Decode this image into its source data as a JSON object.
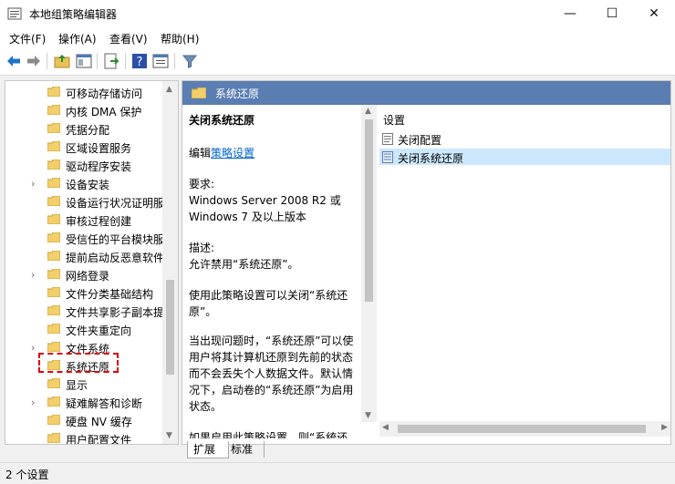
{
  "window": {
    "title": "本地组策略编辑器",
    "minimize": "—",
    "maximize": "☐",
    "close": "✕"
  },
  "menu": [
    "文件(F)",
    "操作(A)",
    "查看(V)",
    "帮助(H)"
  ],
  "tree": {
    "items": [
      {
        "label": "可移动存储访问",
        "expandable": false
      },
      {
        "label": "内核 DMA 保护",
        "expandable": false
      },
      {
        "label": "凭据分配",
        "expandable": false
      },
      {
        "label": "区域设置服务",
        "expandable": false
      },
      {
        "label": "驱动程序安装",
        "expandable": false
      },
      {
        "label": "设备安装",
        "expandable": true
      },
      {
        "label": "设备运行状况证明服",
        "expandable": false
      },
      {
        "label": "审核过程创建",
        "expandable": false
      },
      {
        "label": "受信任的平台模块服",
        "expandable": false
      },
      {
        "label": "提前启动反恶意软件",
        "expandable": false
      },
      {
        "label": "网络登录",
        "expandable": true
      },
      {
        "label": "文件分类基础结构",
        "expandable": false
      },
      {
        "label": "文件共享影子副本提",
        "expandable": false
      },
      {
        "label": "文件夹重定向",
        "expandable": false
      },
      {
        "label": "文件系统",
        "expandable": true
      },
      {
        "label": "系统还原",
        "expandable": false
      },
      {
        "label": "显示",
        "expandable": false
      },
      {
        "label": "疑难解答和诊断",
        "expandable": true
      },
      {
        "label": "硬盘 NV 缓存",
        "expandable": false
      },
      {
        "label": "用户配置文件",
        "expandable": false
      }
    ],
    "selected": "系统还原"
  },
  "panel": {
    "header": "系统还原",
    "desc_title": "关闭系统还原",
    "edit_prefix": "编辑",
    "edit_link": "策略设置",
    "req_label": "要求:",
    "req_text": "Windows Server 2008 R2 或 Windows 7 及以上版本",
    "desc_label": "描述:",
    "desc_1": "允许禁用“系统还原”。",
    "desc_2": "使用此策略设置可以关闭“系统还原”。",
    "desc_3": "当出现问题时，“系统还原”可以使用户将其计算机还原到先前的状态而不会丢失个人数据文件。默认情况下，启动卷的“系统还原”为启用状态。",
    "desc_4": "如果启用此策略设置，则“系统还"
  },
  "list": {
    "header": "设置",
    "items": [
      "关闭配置",
      "关闭系统还原"
    ],
    "selected": "关闭系统还原"
  },
  "tabs": [
    "扩展",
    "标准"
  ],
  "status": "2 个设置",
  "colors": {
    "header": "#5a7db2",
    "selected_row": "#cce8ff",
    "link": "#0066cc",
    "highlight": "#e00000"
  }
}
